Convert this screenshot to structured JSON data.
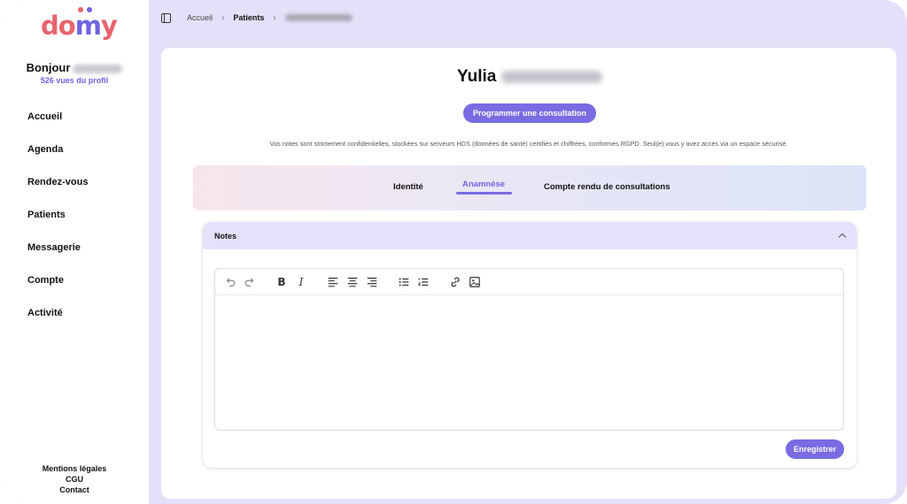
{
  "sidebar": {
    "logo": "domy",
    "greeting": "Bonjour",
    "profile_views": "526 vues du profil",
    "nav": [
      {
        "label": "Accueil"
      },
      {
        "label": "Agenda"
      },
      {
        "label": "Rendez-vous"
      },
      {
        "label": "Patients"
      },
      {
        "label": "Messagerie"
      },
      {
        "label": "Compte"
      },
      {
        "label": "Activité"
      }
    ],
    "footer": {
      "legal": "Mentions légales",
      "cgu": "CGU",
      "contact": "Contact"
    }
  },
  "breadcrumb": {
    "home": "Accueil",
    "patients": "Patients"
  },
  "patient": {
    "first_name": "Yulia",
    "schedule_button": "Programmer une consultation",
    "notice": "Vos notes sont strictement confidentielles, stockées sur serveurs HDS (données de santé) certifiés et chiffrées, conformes RGPD. Seul(e) vous y avez accès via un espace sécurisé."
  },
  "tabs": [
    {
      "label": "Identité",
      "active": false
    },
    {
      "label": "Anamnèse",
      "active": true
    },
    {
      "label": "Compte rendu de consultations",
      "active": false
    }
  ],
  "notes": {
    "title": "Notes",
    "save_button": "Enregistrer",
    "toolbar_icons": [
      "undo-icon",
      "redo-icon",
      "bold-icon",
      "italic-icon",
      "align-left-icon",
      "align-center-icon",
      "align-right-icon",
      "bullet-list-icon",
      "numbered-list-icon",
      "link-icon",
      "image-icon"
    ]
  },
  "colors": {
    "accent": "#786ce3",
    "brand_red": "#e8636e",
    "background": "#e3e1fa"
  }
}
